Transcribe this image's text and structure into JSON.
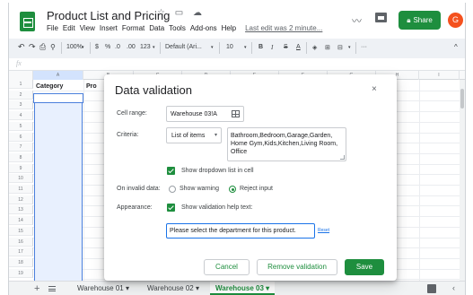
{
  "app": {
    "title": "Product List and Pricing",
    "title_icons": "☆ ▭ ☁",
    "menu": [
      "File",
      "Edit",
      "View",
      "Insert",
      "Format",
      "Data",
      "Tools",
      "Add-ons",
      "Help"
    ],
    "last_edit": "Last edit was 2 minute...",
    "share_label": "Share",
    "avatar_initial": "G",
    "accent_color": "#1e8e3e"
  },
  "toolbar": {
    "undo": "↶",
    "redo": "↷",
    "print": "⎙",
    "paint_format": "⚲",
    "zoom": "100%",
    "currency": "$",
    "percent": "%",
    "dec_decrease": ".0",
    "dec_increase": ".00",
    "more_formats": "123",
    "font": "Default (Ari...",
    "font_size": "10",
    "bold": "B",
    "italic": "I",
    "strike": "S",
    "text_color": "A",
    "fill": "◈",
    "borders": "⊞",
    "merge": "⊟",
    "more": "···",
    "collapse": "^"
  },
  "formula_bar": {
    "fx": "fx"
  },
  "grid": {
    "columns": [
      "A",
      "B",
      "C",
      "D",
      "E",
      "F",
      "G",
      "H",
      "I"
    ],
    "rows": [
      "1",
      "2",
      "3",
      "4",
      "5",
      "6",
      "7",
      "8",
      "9",
      "10",
      "11",
      "12",
      "13",
      "14",
      "15",
      "16",
      "17",
      "18",
      "19"
    ],
    "cell_a1": "Category",
    "cell_b1": "Pro"
  },
  "dialog": {
    "title": "Data validation",
    "close": "×",
    "cell_range_label": "Cell range:",
    "cell_range_value": "Warehouse 03!A",
    "criteria_label": "Criteria:",
    "criteria_type": "List of items",
    "criteria_caret": "▾",
    "list_values": "Bathroom,Bedroom,Garage,Garden, Home Gym,Kids,Kitchen,Living Room, Office",
    "show_dropdown_label": "Show dropdown list in cell",
    "invalid_label": "On invalid data:",
    "show_warning": "Show warning",
    "reject_input": "Reject input",
    "appearance_label": "Appearance:",
    "show_help_label": "Show validation help text:",
    "help_text": "Please select the department for this product.",
    "reset": "Reset",
    "cancel": "Cancel",
    "remove": "Remove validation",
    "save": "Save"
  },
  "sheets": {
    "add": "+",
    "tabs": [
      {
        "label": "Warehouse 01 ▾",
        "active": false
      },
      {
        "label": "Warehouse 02 ▾",
        "active": false
      },
      {
        "label": "Warehouse 03 ▾",
        "active": true
      }
    ],
    "collapse": "‹"
  }
}
